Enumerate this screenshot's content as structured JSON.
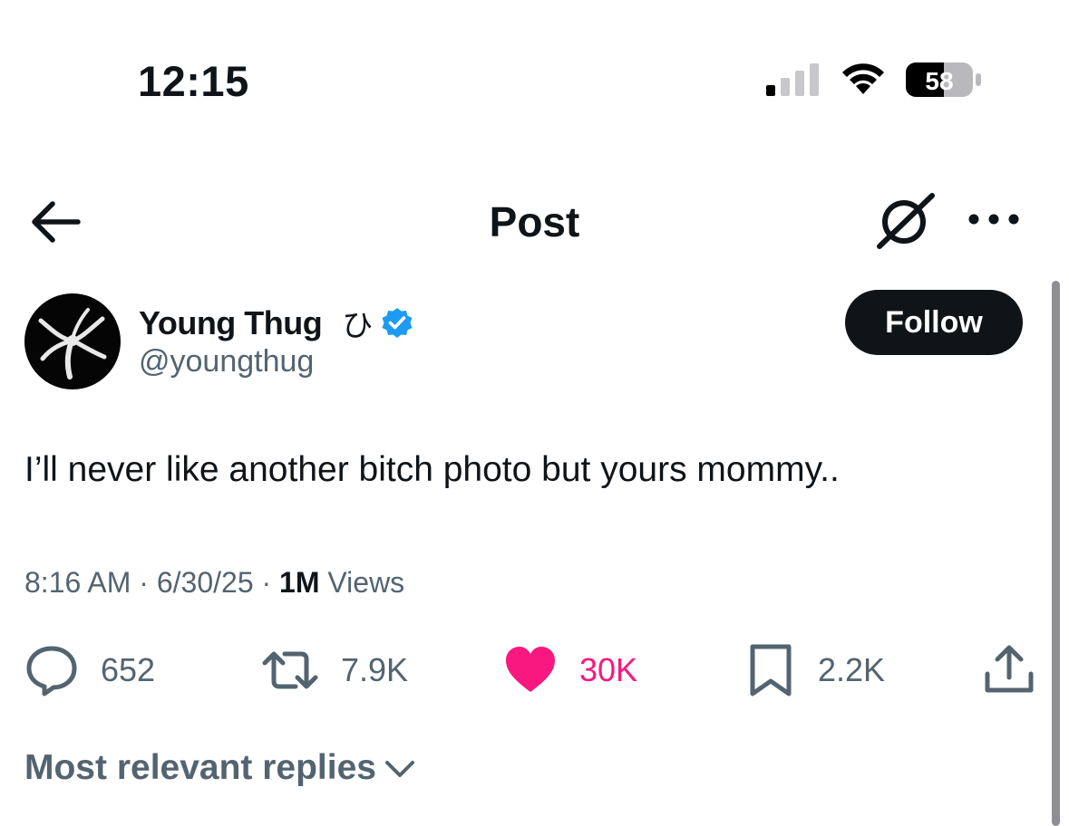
{
  "status_bar": {
    "time": "12:15",
    "battery_level": "58",
    "signal_bars_active": 1,
    "signal_bars_total": 4
  },
  "header": {
    "title": "Post",
    "icons": [
      "back-arrow-icon",
      "grok-icon",
      "more-icon"
    ]
  },
  "post": {
    "author_name": "Young Thug",
    "author_glyph": "ひ",
    "verified": true,
    "handle": "@youngthug",
    "follow_label": "Follow",
    "text": "I’ll never like another bitch photo but yours mommy..",
    "time": "8:16 AM",
    "date": "6/30/25",
    "views_count": "1M",
    "views_label": "Views",
    "separator": "·"
  },
  "actions": {
    "replies": "652",
    "reposts": "7.9K",
    "likes": "30K",
    "bookmarks": "2.2K"
  },
  "replies_sort": {
    "label": "Most relevant replies"
  },
  "colors": {
    "text": "#0f1419",
    "secondary": "#536471",
    "like": "#f91880",
    "verified": "#1d9bf0"
  }
}
